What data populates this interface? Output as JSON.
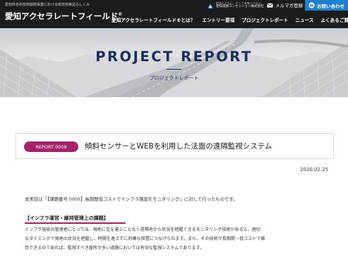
{
  "header": {
    "brand_sub": "愛知県名科技術開発事業における新技術実証のしくみ",
    "brand_title": "愛知アクセラレートフィールド",
    "brand_mark": "®",
    "partner_tagline": "地域とともに、そして未来へつなぐ。",
    "partner_name": "愛知道路コンセッション株式会社",
    "mail_label": "メルマガ登録",
    "contact_label": "お問い合わせ",
    "nav": [
      "愛知アクセラレートフィールド®とは？",
      "エントリー要項",
      "プロジェクトレポート",
      "ニュース",
      "よくあるご質問"
    ]
  },
  "hero": {
    "title": "PROJECT REPORT",
    "subtitle": "プロジェクトレポート"
  },
  "report": {
    "badge": "REPORT 0008",
    "title": "傾斜センサーとWEBを利用した法面の遠隔監視システム",
    "date": "2020.02.25"
  },
  "content": {
    "intro": "本実証は「【課題番号 0005】長期間低コストでインフラ施設をモニタリング」に対して行ったものです。",
    "section_heading": "【インフラ運営・維持管理上の課題】",
    "body_lines": [
      "インフラ施設の管理者にとっては、現地に足を運ぶことなく遠隔地から状況を把握できるモニタリング技術があると、適切",
      "なタイミングで現地の状況を把握し、時期を逸さずに的確な措置につなげられます。また、その技術が長期間・低コストで維",
      "持できるのであれば、監視すべき箇所が多い道路においては有効な監視システムであります。"
    ]
  },
  "colors": {
    "header_bg": "#1c1c1c",
    "contact_bg": "#1e7fd0",
    "accent": "#a6236b",
    "hero_text": "#1e2c58"
  },
  "icons": {
    "partner": "rising-sun-logo-icon",
    "mail": "envelope-icon",
    "contact": "mail-in-circle-icon"
  }
}
